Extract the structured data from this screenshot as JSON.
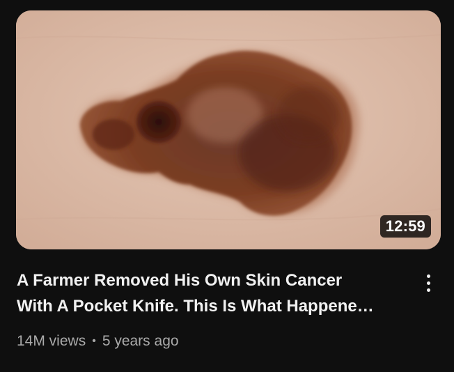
{
  "video": {
    "duration": "12:59",
    "title_line1": "A Farmer Removed His Own Skin Cancer",
    "title_line2": "With A Pocket Knife. This Is What Happene…",
    "views": "14M views",
    "separator": "•",
    "age": "5 years ago",
    "menu_icon": "more-vert-icon"
  },
  "colors": {
    "background": "#0f0f0f",
    "title": "#f1f1f1",
    "meta": "#aaaaaa",
    "skin": "#dcbca9",
    "lesion_dark": "#3a150c",
    "lesion_mid": "#7a3a22"
  }
}
